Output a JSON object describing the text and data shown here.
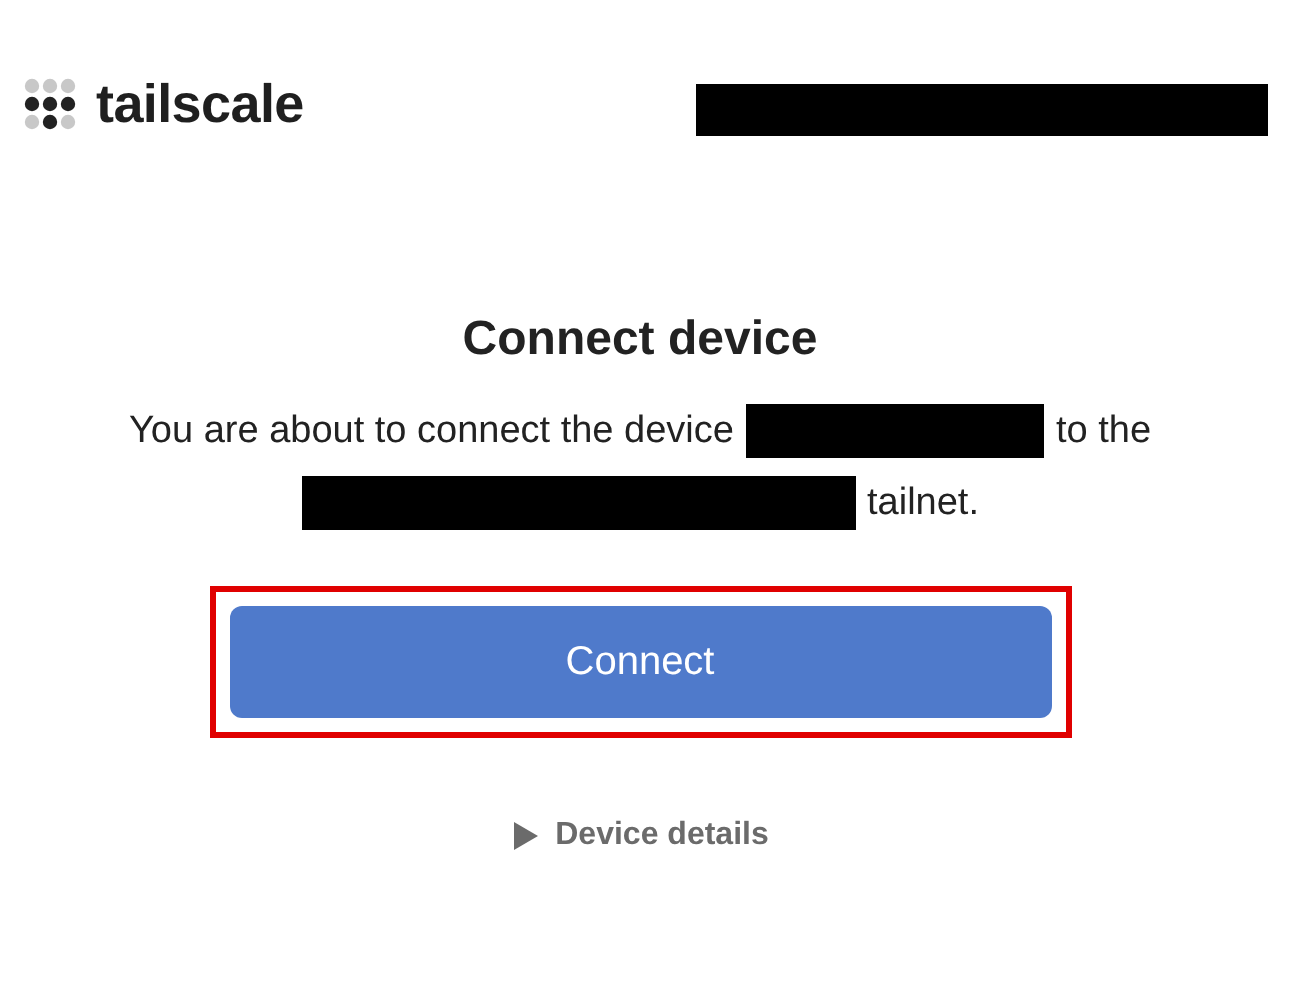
{
  "header": {
    "logo_text": "tailscale",
    "account": {
      "kind": "redacted"
    }
  },
  "title": "Connect device",
  "message": [
    {
      "kind": "text",
      "text": "You are about to connect the device"
    },
    {
      "kind": "redacted"
    },
    {
      "kind": "text",
      "text": "to the"
    },
    {
      "kind": "break"
    },
    {
      "kind": "redacted"
    },
    {
      "kind": "text",
      "text": "tailnet."
    }
  ],
  "connect_button": {
    "label": "Connect",
    "highlighted": true
  },
  "details": {
    "label": "Device details",
    "expanded": false
  }
}
